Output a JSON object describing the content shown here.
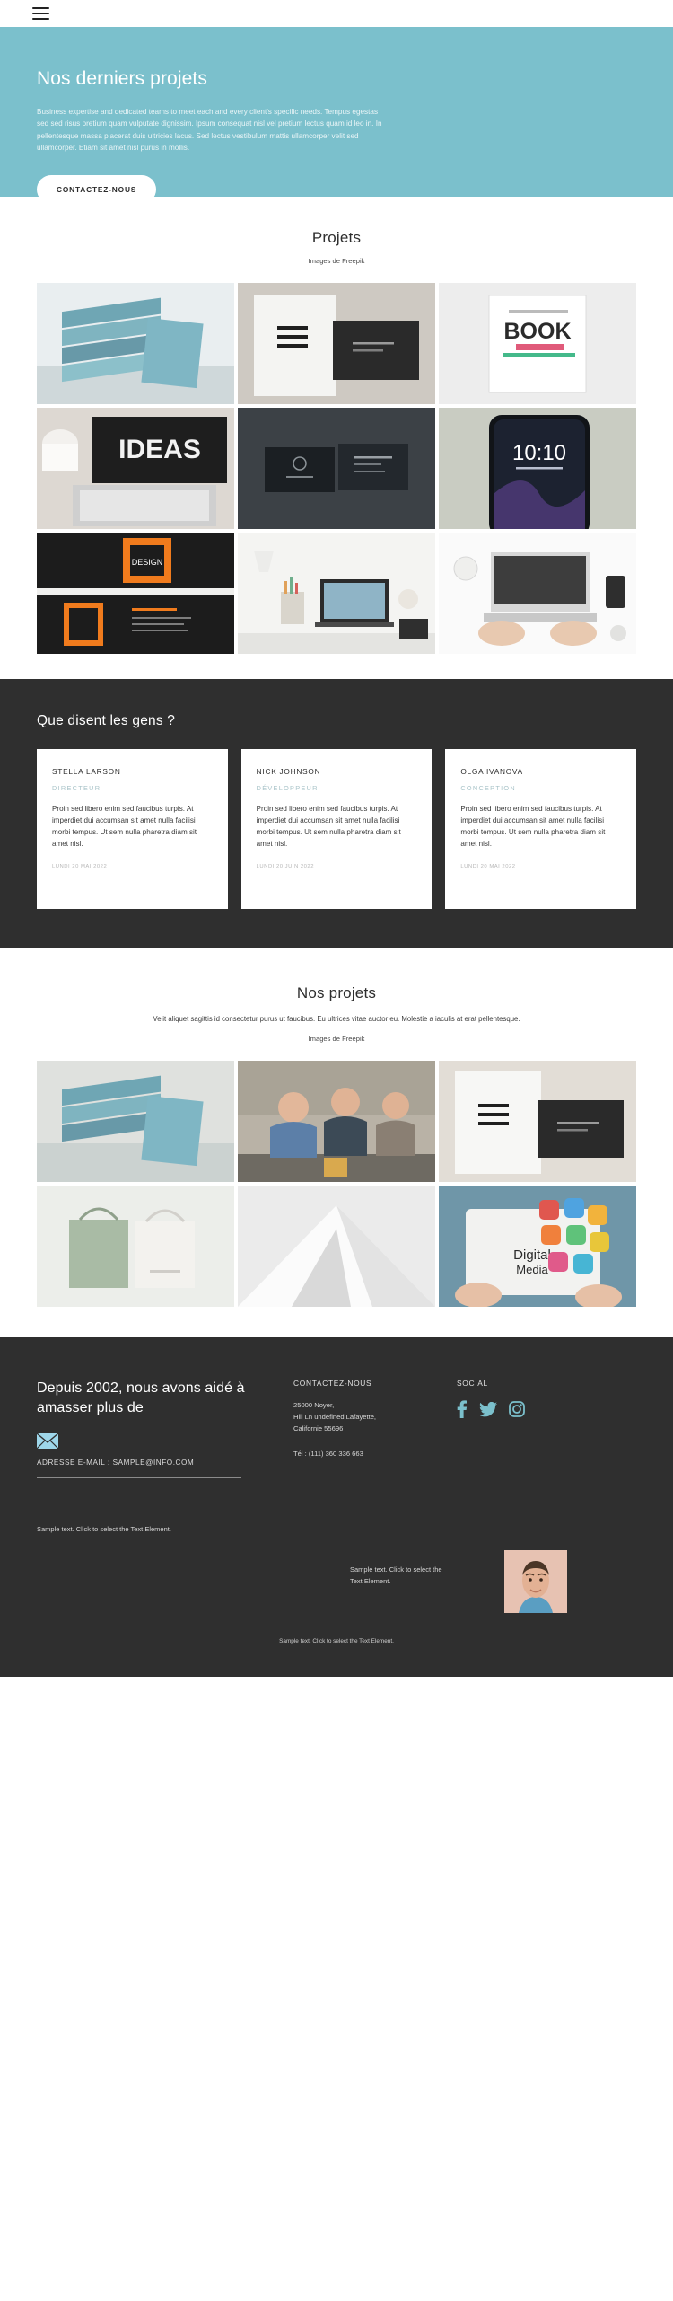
{
  "header": {
    "menu_icon": "hamburger-menu-icon"
  },
  "hero": {
    "title": "Nos derniers projets",
    "text": "Business expertise and dedicated teams to meet each and every client's specific needs. Tempus egestas sed sed risus pretium quam vulputate dignissim. Ipsum consequat nisl vel pretium lectus quam id leo in. In pellentesque massa placerat duis ultricies lacus. Sed lectus vestibulum mattis ullamcorper velit sed ullamcorper. Etiam sit amet nisl purus in mollis.",
    "cta_label": "CONTACTEZ-NOUS",
    "bg_color": "#7bc0cc"
  },
  "projets": {
    "title": "Projets",
    "credit": "Images de Freepik",
    "items": [
      {
        "alt": "stacked-books-mockup"
      },
      {
        "alt": "black-white-business-cards"
      },
      {
        "alt": "book-cover-mockup"
      },
      {
        "alt": "laptop-ideas-desk"
      },
      {
        "alt": "dark-business-card-stack"
      },
      {
        "alt": "smartphone-mockup-1010"
      },
      {
        "alt": "orange-black-business-cards"
      },
      {
        "alt": "desk-laptop-stationery"
      },
      {
        "alt": "overhead-desk-hands-typing"
      }
    ]
  },
  "testimonials": {
    "title": "Que disent les gens ?",
    "cards": [
      {
        "name": "STELLA LARSON",
        "role": "DIRECTEUR",
        "text": "Proin sed libero enim sed faucibus turpis. At imperdiet dui accumsan sit amet nulla facilisi morbi tempus. Ut sem nulla pharetra diam sit amet nisl.",
        "date": "LUNDI 20 MAI 2022"
      },
      {
        "name": "NICK JOHNSON",
        "role": "DÉVELOPPEUR",
        "text": "Proin sed libero enim sed faucibus turpis. At imperdiet dui accumsan sit amet nulla facilisi morbi tempus. Ut sem nulla pharetra diam sit amet nisl.",
        "date": "LUNDI 20 JUIN 2022"
      },
      {
        "name": "OLGA IVANOVA",
        "role": "CONCEPTION",
        "text": "Proin sed libero enim sed faucibus turpis. At imperdiet dui accumsan sit amet nulla facilisi morbi tempus. Ut sem nulla pharetra diam sit amet nisl.",
        "date": "LUNDI 20 MAI 2022"
      }
    ],
    "bg_color": "#2f2f2f"
  },
  "nosprojets": {
    "title": "Nos projets",
    "lead": "Velit aliquet sagittis id consectetur purus ut faucibus. Eu ultrices vitae auctor eu. Molestie a iaculis at erat pellentesque.",
    "credit": "Images de Freepik",
    "items": [
      {
        "alt": "stacked-books-mockup"
      },
      {
        "alt": "team-meeting-office"
      },
      {
        "alt": "white-business-cards"
      },
      {
        "alt": "paper-shopping-bags"
      },
      {
        "alt": "abstract-white-geometry"
      },
      {
        "alt": "tablet-digital-media-icons"
      }
    ]
  },
  "footer": {
    "headline": "Depuis 2002, nous avons aidé à amasser plus de",
    "mail_icon": "envelope-icon",
    "email_label": "ADRESSE E-MAIL : SAMPLE@INFO.COM",
    "contact": {
      "title": "CONTACTEZ-NOUS",
      "address": "25000 Noyer,\nHill Ln undefined Lafayette,\nCalifornie 55696",
      "phone": "Tél :  (111) 360 336 663"
    },
    "social": {
      "title": "SOCIAL",
      "icons": [
        "facebook-icon",
        "twitter-icon",
        "instagram-icon"
      ],
      "color": "#7bc0cc"
    },
    "sample_left": "Sample text. Click to select the Text Element.",
    "sample_mid": "Sample text. Click to select the Text Element.",
    "sample_bottom": "Sample text. Click to select the Text Element.",
    "portrait_alt": "portrait-young-man",
    "bg_color": "#2f2f2f"
  }
}
